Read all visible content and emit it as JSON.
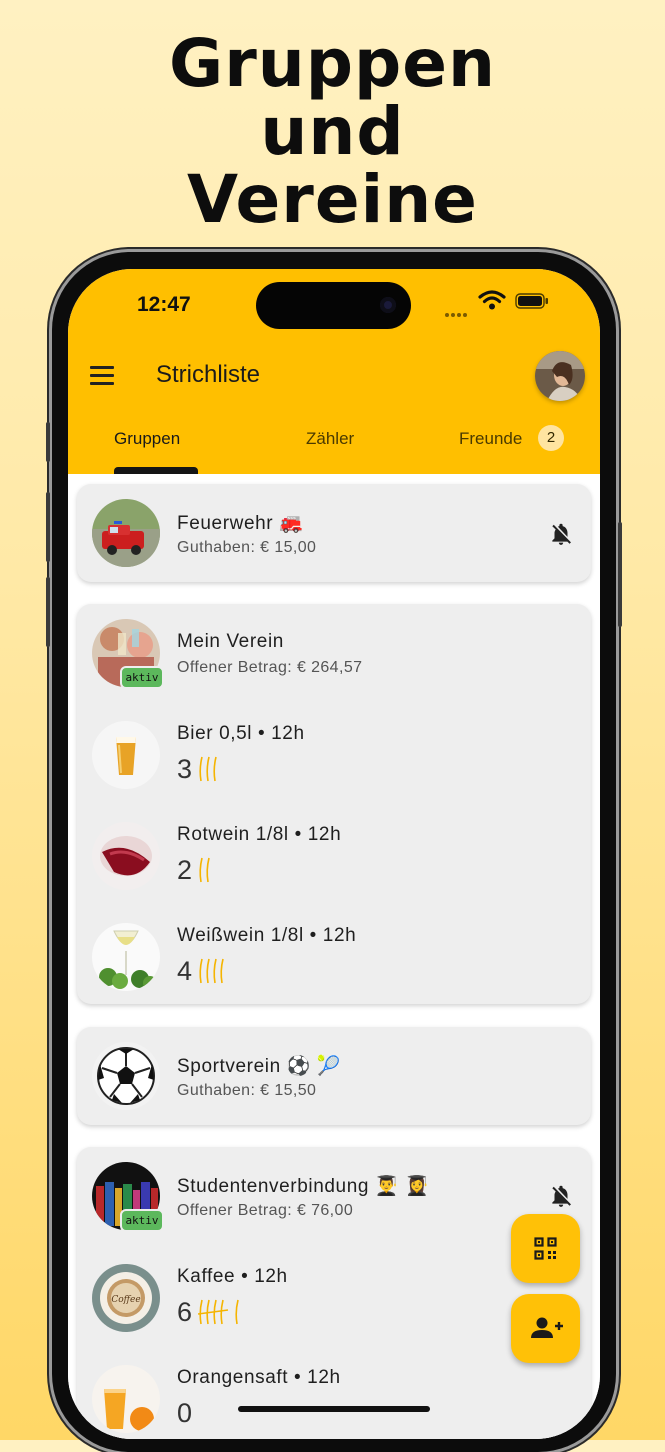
{
  "headline": [
    "Gruppen",
    "und",
    "Vereine"
  ],
  "status": {
    "time": "12:47"
  },
  "appbar": {
    "title": "Strichliste"
  },
  "tabs": [
    {
      "label": "Gruppen",
      "active": true
    },
    {
      "label": "Zähler",
      "active": false
    },
    {
      "label": "Freunde",
      "active": false,
      "badge": "2"
    }
  ],
  "groups": {
    "feuerwehr": {
      "name": "Feuerwehr 🚒",
      "balance": "Guthaben: € 15,00",
      "muted": true
    },
    "verein": {
      "name": "Mein Verein",
      "balance": "Offener Betrag: € 264,57",
      "badge": "aktiv",
      "items": [
        {
          "name": "Bier 0,5l • 12h",
          "count": "3"
        },
        {
          "name": "Rotwein 1/8l • 12h",
          "count": "2"
        },
        {
          "name": "Weißwein 1/8l • 12h",
          "count": "4"
        }
      ]
    },
    "sport": {
      "name": "Sportverein ⚽ 🎾",
      "balance": "Guthaben: € 15,50"
    },
    "studenten": {
      "name": "Studentenverbindung 👨‍🎓 👩‍🎓",
      "balance": "Offener Betrag: € 76,00",
      "badge": "aktiv",
      "muted": true,
      "items": [
        {
          "name": "Kaffee • 12h",
          "count": "6",
          "thumb_text": "Coffee"
        },
        {
          "name": "Orangensaft • 12h",
          "count": "0"
        }
      ]
    }
  },
  "colors": {
    "accent": "#ffbf00",
    "fab": "#ffc107",
    "tally": "#f5b400",
    "aktiv": "#5cb85c"
  },
  "icons": [
    "menu-icon",
    "bell-off-icon",
    "qr-code-icon",
    "add-person-icon",
    "wifi-icon",
    "battery-icon"
  ]
}
